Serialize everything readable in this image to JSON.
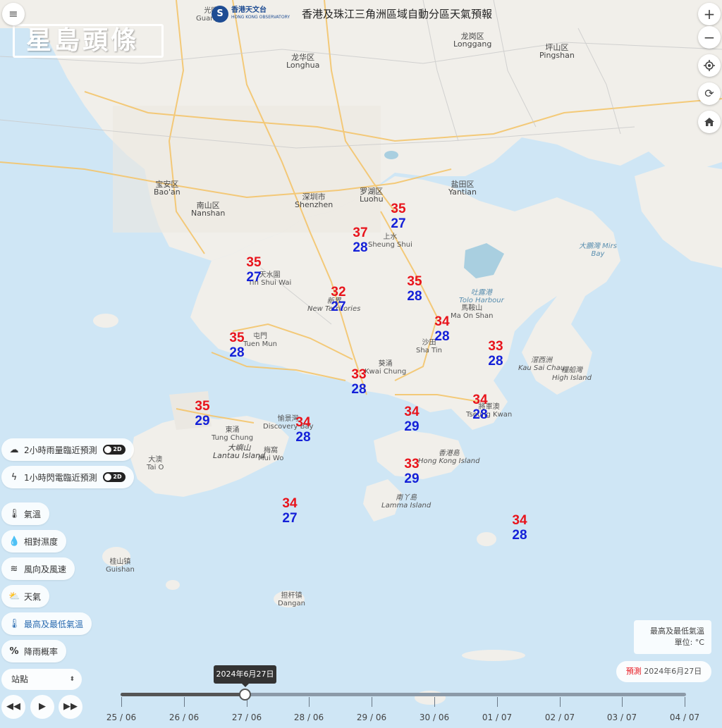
{
  "header": {
    "title": "香港及珠江三角洲區域自動分區天氣預報",
    "hko_logo_zh": "香港天文台",
    "hko_logo_en": "HONG KONG OBSERVATORY",
    "brand": "星島頭條"
  },
  "map_controls": {
    "zoom_in": "+",
    "zoom_out": "−",
    "locate_icon": "locate-icon",
    "refresh_icon": "refresh-icon",
    "home_icon": "home-icon",
    "menu_icon": "menu-icon"
  },
  "place_labels": [
    {
      "zh": "光明",
      "en": "Guangm"
    },
    {
      "zh": "龙华区",
      "en": "Longhua"
    },
    {
      "zh": "龙岗区",
      "en": "Longgang"
    },
    {
      "zh": "坪山区",
      "en": "Pingshan"
    },
    {
      "zh": "宝安区",
      "en": "Bao'an"
    },
    {
      "zh": "南山区",
      "en": "Nanshan"
    },
    {
      "zh": "深圳市",
      "en": "Shenzhen"
    },
    {
      "zh": "罗湖区",
      "en": "Luohu"
    },
    {
      "zh": "盐田区",
      "en": "Yantian"
    },
    {
      "zh": "大鵬灣 Mirs",
      "en": "Bay"
    },
    {
      "zh": "上水",
      "en": "Sheung Shui"
    },
    {
      "zh": "天水圍",
      "en": "Tin Shui Wai"
    },
    {
      "zh": "新界",
      "en": "New Territories"
    },
    {
      "zh": "吐露港",
      "en": "Tolo Harbour"
    },
    {
      "zh": "馬鞍山",
      "en": "Ma On Shan"
    },
    {
      "zh": "屯門",
      "en": "Tuen Mun"
    },
    {
      "zh": "沙田",
      "en": "Sha Tin"
    },
    {
      "zh": "滘西洲",
      "en": "Kau Sai Chau"
    },
    {
      "zh": "糧船灣",
      "en": "High Island"
    },
    {
      "zh": "葵涌",
      "en": "Kwai Chung"
    },
    {
      "zh": "愉景灣",
      "en": "Discovery Bay"
    },
    {
      "zh": "東涌",
      "en": "Tung Chung"
    },
    {
      "zh": "大嶼山",
      "en": "Lantau Island"
    },
    {
      "zh": "梅窩",
      "en": "Mui Wo"
    },
    {
      "zh": "大澳",
      "en": "Tai O"
    },
    {
      "zh": "香港島",
      "en": "Hong Kong Island"
    },
    {
      "zh": "南丫島",
      "en": "Lamma Island"
    },
    {
      "zh": "桂山镇",
      "en": "Guishan"
    },
    {
      "zh": "担杆镇",
      "en": "Dangan"
    },
    {
      "zh": "將軍澳",
      "en": "Tseung Kwan"
    }
  ],
  "temperatures": [
    {
      "station": "north-shenzhen",
      "max": "35",
      "min": "27"
    },
    {
      "station": "sheung-shui",
      "max": "37",
      "min": "28"
    },
    {
      "station": "tin-shui-wai",
      "max": "35",
      "min": "27"
    },
    {
      "station": "tai-po",
      "max": "35",
      "min": "28"
    },
    {
      "station": "new-territories",
      "max": "32",
      "min": "27"
    },
    {
      "station": "ma-on-shan",
      "max": "34",
      "min": "28"
    },
    {
      "station": "tuen-mun",
      "max": "35",
      "min": "28"
    },
    {
      "station": "sai-kung",
      "max": "33",
      "min": "28"
    },
    {
      "station": "kwai-chung",
      "max": "33",
      "min": "28"
    },
    {
      "station": "airport",
      "max": "35",
      "min": "29"
    },
    {
      "station": "discovery-bay",
      "max": "34",
      "min": "28"
    },
    {
      "station": "kowloon",
      "max": "34",
      "min": "29"
    },
    {
      "station": "tseung-kwan-o",
      "max": "34",
      "min": "28"
    },
    {
      "station": "hong-kong-island",
      "max": "33",
      "min": "29"
    },
    {
      "station": "cheung-chau",
      "max": "34",
      "min": "27"
    },
    {
      "station": "waglan",
      "max": "34",
      "min": "28"
    }
  ],
  "panel": {
    "rain_nowcast": "2小時雨量臨近預測",
    "rain_toggle": "2D",
    "lightning_nowcast": "1小時閃電臨近預測",
    "lightning_toggle": "2D",
    "temperature": "氣溫",
    "humidity": "相對濕度",
    "wind": "風向及風速",
    "weather": "天氣",
    "max_min_temp": "最高及最低氣溫",
    "rain_probability": "降雨概率",
    "station_select": "站點"
  },
  "legend": {
    "title": "最高及最低氣溫",
    "unit": "單位: °C"
  },
  "forecast": {
    "keyword": "預測",
    "date": "2024年6月27日"
  },
  "timeline": {
    "tooltip": "2024年6月27日",
    "selected_index": 2,
    "labels": [
      "25 / 06",
      "26 / 06",
      "27 / 06",
      "28 / 06",
      "29 / 06",
      "30 / 06",
      "01 / 07",
      "02 / 07",
      "03 / 07",
      "04 / 07"
    ]
  },
  "colors": {
    "max_temp": "#e8131b",
    "min_temp": "#1420d8",
    "sea": "#cfe6f5",
    "land": "#f2f0ec"
  }
}
